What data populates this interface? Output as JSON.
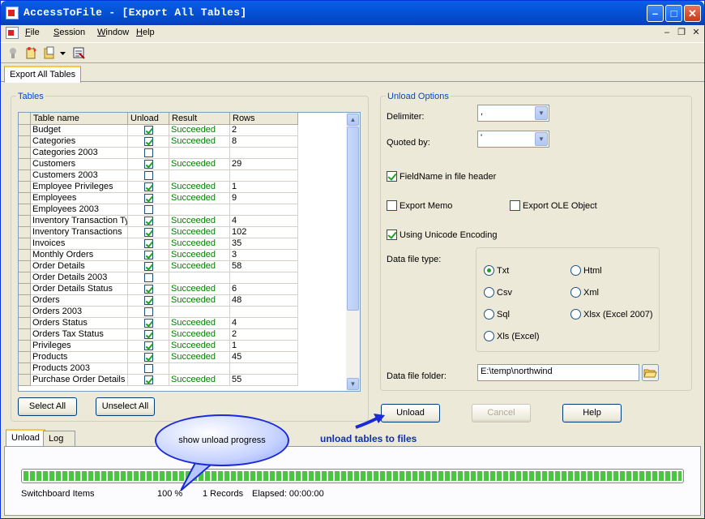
{
  "window": {
    "title": "AccessToFile - [Export All Tables]"
  },
  "menu": {
    "items": [
      {
        "key": "F",
        "rest": "ile"
      },
      {
        "key": "S",
        "rest": "ession"
      },
      {
        "key": "W",
        "rest": "indow"
      },
      {
        "key": "H",
        "rest": "elp"
      }
    ],
    "mdi_minimize": "–",
    "mdi_restore": "❐",
    "mdi_close": "✕"
  },
  "doc_tab": "Export All Tables",
  "tables": {
    "group_title": "Tables",
    "columns": [
      "Table name",
      "Unload",
      "Result",
      "Rows"
    ],
    "rows": [
      {
        "name": "Budget",
        "unload": true,
        "result": "Succeeded",
        "rows": "2"
      },
      {
        "name": "Categories",
        "unload": true,
        "result": "Succeeded",
        "rows": "8"
      },
      {
        "name": "Categories 2003",
        "unload": false,
        "result": "",
        "rows": ""
      },
      {
        "name": "Customers",
        "unload": true,
        "result": "Succeeded",
        "rows": "29"
      },
      {
        "name": "Customers 2003",
        "unload": false,
        "result": "",
        "rows": ""
      },
      {
        "name": "Employee Privileges",
        "unload": true,
        "result": "Succeeded",
        "rows": "1"
      },
      {
        "name": "Employees",
        "unload": true,
        "result": "Succeeded",
        "rows": "9"
      },
      {
        "name": "Employees 2003",
        "unload": false,
        "result": "",
        "rows": ""
      },
      {
        "name": "Inventory Transaction Ty",
        "unload": true,
        "result": "Succeeded",
        "rows": "4"
      },
      {
        "name": "Inventory Transactions",
        "unload": true,
        "result": "Succeeded",
        "rows": "102"
      },
      {
        "name": "Invoices",
        "unload": true,
        "result": "Succeeded",
        "rows": "35"
      },
      {
        "name": "Monthly Orders",
        "unload": true,
        "result": "Succeeded",
        "rows": "3"
      },
      {
        "name": "Order Details",
        "unload": true,
        "result": "Succeeded",
        "rows": "58"
      },
      {
        "name": "Order Details 2003",
        "unload": false,
        "result": "",
        "rows": ""
      },
      {
        "name": "Order Details Status",
        "unload": true,
        "result": "Succeeded",
        "rows": "6"
      },
      {
        "name": "Orders",
        "unload": true,
        "result": "Succeeded",
        "rows": "48"
      },
      {
        "name": "Orders 2003",
        "unload": false,
        "result": "",
        "rows": ""
      },
      {
        "name": "Orders Status",
        "unload": true,
        "result": "Succeeded",
        "rows": "4"
      },
      {
        "name": "Orders Tax Status",
        "unload": true,
        "result": "Succeeded",
        "rows": "2"
      },
      {
        "name": "Privileges",
        "unload": true,
        "result": "Succeeded",
        "rows": "1"
      },
      {
        "name": "Products",
        "unload": true,
        "result": "Succeeded",
        "rows": "45"
      },
      {
        "name": "Products 2003",
        "unload": false,
        "result": "",
        "rows": ""
      },
      {
        "name": "Purchase Order Details",
        "unload": true,
        "result": "Succeeded",
        "rows": "55"
      }
    ],
    "select_all": "Select All",
    "unselect_all": "Unselect All"
  },
  "options": {
    "group_title": "Unload Options",
    "delimiter_label": "Delimiter:",
    "delimiter_value": ",",
    "quoted_label": "Quoted by:",
    "quoted_value": "'",
    "fieldname_header": "FieldName in file header",
    "fieldname_header_checked": true,
    "export_memo": "Export Memo",
    "export_memo_checked": false,
    "export_ole": "Export OLE Object",
    "export_ole_checked": false,
    "unicode": "Using Unicode Encoding",
    "unicode_checked": true,
    "data_type_label": "Data file type:",
    "types": [
      "Txt",
      "Html",
      "Csv",
      "Xml",
      "Sql",
      "Xlsx (Excel 2007)",
      "Xls (Excel)"
    ],
    "selected_type": "Txt",
    "folder_label": "Data file folder:",
    "folder_value": "E:\\temp\\northwind"
  },
  "actions": {
    "unload": "Unload",
    "cancel": "Cancel",
    "help": "Help"
  },
  "bottom_tabs": [
    "Unload",
    "Log"
  ],
  "progress": {
    "current_table": "Switchboard Items",
    "percent_text": "100 %",
    "percent": 100,
    "records": "1 Records",
    "elapsed": "Elapsed: 00:00:00"
  },
  "annotations": {
    "callout": "show unload progress",
    "hint": "unload tables to files"
  },
  "colors": {
    "title_bar": "#0453d8",
    "group_title": "#0046d5",
    "succeeded": "#008000",
    "progress": "#46c83c",
    "hint": "#0d2fb0"
  }
}
